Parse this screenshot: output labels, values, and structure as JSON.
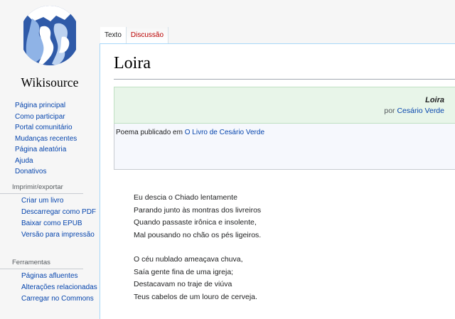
{
  "sidebar": {
    "logo_text": "Wikisource",
    "main_links": [
      "Página principal",
      "Como participar",
      "Portal comunitário",
      "Mudanças recentes",
      "Página aleatória",
      "Ajuda",
      "Donativos"
    ],
    "print_heading": "Imprimir/exportar",
    "print_links": [
      "Criar um livro",
      "Descarregar como PDF",
      "Baixar como EPUB",
      "Versão para impressão"
    ],
    "tools_heading": "Ferramentas",
    "tools_links": [
      "Páginas afluentes",
      "Alterações relacionadas",
      "Carregar no Commons"
    ]
  },
  "tabs": {
    "text": "Texto",
    "talk": "Discussão"
  },
  "page": {
    "title": "Loira"
  },
  "header": {
    "work_title": "Loira",
    "by": "por ",
    "author": "Cesário Verde",
    "notes_prefix": "Poema publicado em ",
    "notes_link": "O Livro de Cesário Verde"
  },
  "poem": {
    "stanza1": [
      "Eu descia o Chiado lentamente",
      "Parando junto às montras dos livreiros",
      "Quando passaste irônica e insolente,",
      "Mal pousando no chão os pés ligeiros."
    ],
    "stanza2": [
      "O céu nublado ameaçava chuva,",
      "Saía gente fina de uma igreja;",
      "Destacavam no traje de viúva",
      "Teus cabelos de um louro de cerveja."
    ]
  },
  "colors": {
    "link": "#0645ad",
    "new_link": "#ba0000",
    "header_bg": "#e8f5e9"
  }
}
